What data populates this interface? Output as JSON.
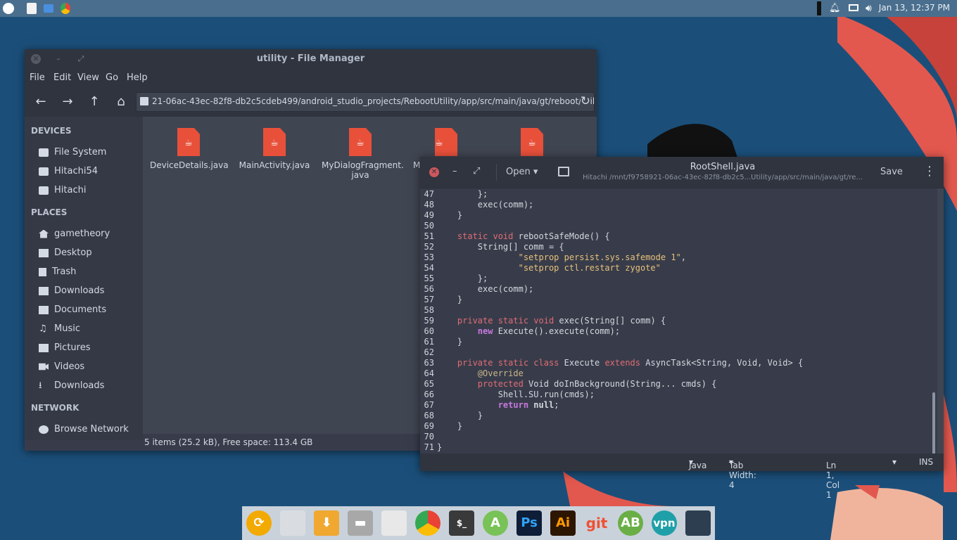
{
  "top_panel": {
    "clock": "Jan 13, 12:37 PM",
    "launchers": [
      "ubuntu-logo-icon",
      "text-editor-icon",
      "file-manager-icon",
      "chrome-icon"
    ],
    "tray": [
      "notification-bell-icon",
      "display-icon",
      "volume-icon"
    ]
  },
  "file_manager": {
    "title": "utility - File Manager",
    "menu": [
      "File",
      "Edit",
      "View",
      "Go",
      "Help"
    ],
    "path": "21-06ac-43ec-82f8-db2c5cdeb499/android_studio_projects/RebootUtility/app/src/main/java/gt/reboot/utility/",
    "sidebar": {
      "devices_header": "DEVICES",
      "devices": [
        "File System",
        "Hitachi54",
        "Hitachi"
      ],
      "places_header": "PLACES",
      "places": [
        "gametheory",
        "Desktop",
        "Trash",
        "Downloads",
        "Documents",
        "Music",
        "Pictures",
        "Videos",
        "Downloads"
      ],
      "network_header": "NETWORK",
      "network": [
        "Browse Network"
      ]
    },
    "files": [
      "DeviceDetails.java",
      "MainActivity.java",
      "MyDialogFragment.\njava",
      "My",
      "",
      ""
    ],
    "status": "5 items (25.2 kB), Free space: 113.4 GB"
  },
  "editor": {
    "open_label": "Open",
    "filename": "RootShell.java",
    "filepath": "Hitachi /mnt/f9758921-06ac-43ec-82f8-db2c5...Utility/app/src/main/java/gt/re...",
    "save_label": "Save",
    "language": "Java",
    "tab_width": "Tab Width: 4",
    "position": "Ln 1, Col 1",
    "mode": "INS",
    "line_numbers": [
      "47",
      "48",
      "49",
      "50",
      "51",
      "52",
      "53",
      "54",
      "55",
      "56",
      "57",
      "58",
      "59",
      "60",
      "61",
      "62",
      "63",
      "64",
      "65",
      "66",
      "67",
      "68",
      "69",
      "70",
      "71"
    ]
  },
  "dock": {
    "apps": [
      "update-icon",
      "briefcase-icon",
      "download-icon",
      "archive-icon",
      "editor-icon",
      "chrome-icon",
      "terminal-icon",
      "android-studio-icon",
      "photoshop-icon",
      "illustrator-icon",
      "git-icon",
      "adblock-icon",
      "vpn-icon",
      "screenshot-icon"
    ],
    "labels": {
      "ps": "Ps",
      "ai": "Ai",
      "git": "git",
      "ab": "AB",
      "vpn": "vpn"
    }
  }
}
